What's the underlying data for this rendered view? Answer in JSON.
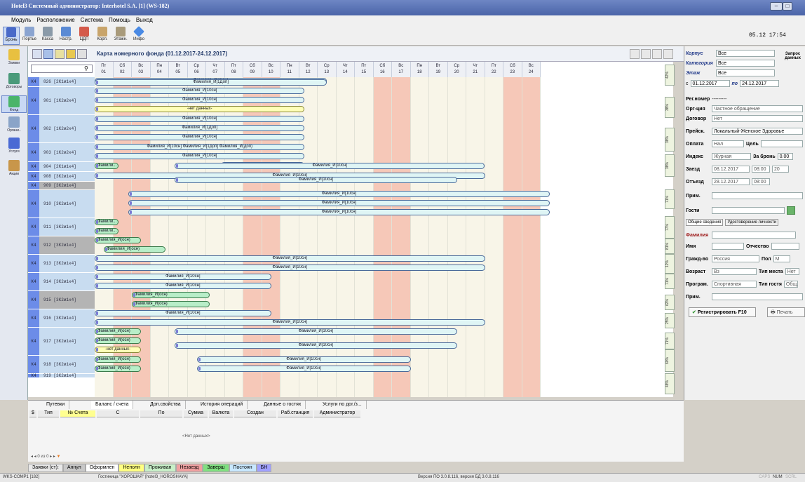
{
  "window": {
    "title": "Hotel3 Системный администратор: Interhotel S.A. [1] (WS-182)"
  },
  "menu": [
    "Модуль",
    "Расположение",
    "Система",
    "Помощь",
    "Выход"
  ],
  "toolbar": {
    "items": [
      "Бронь",
      "Портье",
      "Касса",
      "Настр.",
      "ЦДП",
      "Корп.",
      "Этажн.",
      "Инфо"
    ],
    "clock": "05.12 17:54"
  },
  "left_toolbar": [
    "Заявки",
    "Договоры",
    "Фонд",
    "Органи..",
    "Услуги",
    "Акции"
  ],
  "panel": {
    "title": "Карта номерного фонда (01.12.2017-24.12.2017)"
  },
  "days": [
    [
      "Пт",
      "01"
    ],
    [
      "Сб",
      "02"
    ],
    [
      "Вс",
      "03"
    ],
    [
      "Пн",
      "04"
    ],
    [
      "Вт",
      "05"
    ],
    [
      "Ср",
      "06"
    ],
    [
      "Чт",
      "07"
    ],
    [
      "Пт",
      "08"
    ],
    [
      "Сб",
      "09"
    ],
    [
      "Вс",
      "10"
    ],
    [
      "Пн",
      "11"
    ],
    [
      "Вт",
      "12"
    ],
    [
      "Ср",
      "13"
    ],
    [
      "Чт",
      "14"
    ],
    [
      "Пт",
      "15"
    ],
    [
      "Сб",
      "16"
    ],
    [
      "Вс",
      "17"
    ],
    [
      "Пн",
      "18"
    ],
    [
      "Вт",
      "19"
    ],
    [
      "Ср",
      "20"
    ],
    [
      "Чт",
      "21"
    ],
    [
      "Пт",
      "22"
    ],
    [
      "Сб",
      "23"
    ],
    [
      "Вс",
      "24"
    ]
  ],
  "rooms": [
    {
      "cat": "К4",
      "name": "826 [2К1м1к4]"
    },
    {
      "cat": "К4",
      "name": "901 [1К2м2к4]"
    },
    {
      "cat": "К4",
      "name": "902 [1К2м2к4]"
    },
    {
      "cat": "К4",
      "name": "903 [1К2м2к4]"
    },
    {
      "cat": "К4",
      "name": "904 [2К1м1к4]"
    },
    {
      "cat": "К4",
      "name": "908 [3К2м1к4]"
    },
    {
      "cat": "К4",
      "name": "909 [3К2м1к4]"
    },
    {
      "cat": "К4",
      "name": "910 [3К2м1к4]"
    },
    {
      "cat": "К4",
      "name": "911 [3К2м1к4]"
    },
    {
      "cat": "К4",
      "name": "912 [3К2м1к4]"
    },
    {
      "cat": "К4",
      "name": "913 [3К2м1к4]"
    },
    {
      "cat": "К4",
      "name": "914 [3К2м1к4]"
    },
    {
      "cat": "К4",
      "name": "915 [3К2м1к4]"
    },
    {
      "cat": "К4",
      "name": "916 [3К2м1к4]"
    },
    {
      "cat": "К4",
      "name": "917 [3К2м1к4]"
    },
    {
      "cat": "К4",
      "name": "918 [3К2м1к4]"
    },
    {
      "cat": "К4",
      "name": "919 [3К2м1к4]"
    }
  ],
  "bookings": {
    "b1": "Фамилия_И[10сн]",
    "b2": "Фамилия_И[1Доп]",
    "b3": "-нет данных-",
    "b4": "Фамилия_И(осн)",
    "b5": "Фамили...",
    "b6": "Фамилия_И(доп)",
    "b7": "$",
    "b8": "Фамилия_И[10сн] Фамилия_И[1Доп] Фамилия_И(доп)",
    "b9": "Фамилия_И[1Доп]",
    "b10": "Фамилия_И(осн)"
  },
  "occupancy": [
    "42%",
    "38%",
    "38%",
    "38%",
    "71%",
    "77%",
    "81%",
    "12%",
    "71%",
    "62%",
    "25%",
    "71%",
    "60%",
    "48%"
  ],
  "right": {
    "korpus_label": "Корпус",
    "korpus": "Все",
    "kategoriya_label": "Категория",
    "kategoriya": "Все",
    "etazh_label": "Этаж",
    "etazh": "Все",
    "zapros": "Запрос данных",
    "from_label": "с",
    "from": "01.12.2017",
    "to_label": "по",
    "to": "24.12.2017",
    "regnomer_label": "Рег.номер",
    "regnomer": "---------",
    "org_label": "Орг-ция",
    "org": "Частное обращение",
    "dogovor_label": "Договор",
    "dogovor": "Нет",
    "preisk_label": "Прейск.",
    "preisk": "Локальный-Женское Здоровье",
    "oplata_label": "Оплата",
    "oplata": "Нал",
    "cel_label": "Цель",
    "index_label": "Индекс",
    "index": "Журная",
    "zabron_label": "За бронь",
    "zabron": "0.00",
    "zaezd_label": "Заезд",
    "zaezd": "08.12.2017",
    "zaezd_time": "08:00",
    "zaezd_n": "20",
    "otezd_label": "Отъезд",
    "otezd": "28.12.2017",
    "otezd_time": "08:00",
    "prim_label": "Прим.",
    "gosti_label": "Гости",
    "tab1": "Общие сведения",
    "tab2": "Удостоверение личности",
    "familia_label": "Фамилия",
    "imya_label": "Имя",
    "otchestvo_label": "Отчество",
    "grazhd_label": "Гражд-во",
    "grazhd": "Россия",
    "pol_label": "Пол",
    "pol": "М",
    "vozrast_label": "Возраст",
    "vozrast": "Вз",
    "tipmesta_label": "Тип места",
    "tipmesta": "Нет",
    "program_label": "Програм.",
    "program": "Спортивная",
    "tipgostya_label": "Тип гостя",
    "tipgostya": "Общ.",
    "prim2_label": "Прим.",
    "register": "Регистрировать F10",
    "print": "Печать"
  },
  "bottom": {
    "tabs": [
      "Путевки",
      "Баланс / счета",
      "Доп.свойства",
      "История операций",
      "Данные о гостях",
      "Услуги по дог./з..."
    ],
    "cols": [
      "$",
      "Тип",
      "№ Счета",
      "С",
      "По",
      "Сумма",
      "Валюта",
      "Создан",
      "Раб.станция",
      "Администратор"
    ],
    "empty": "<Нет данных>",
    "pager": "0 из 0"
  },
  "legend": [
    {
      "t": "Заявки (ст):",
      "c": "#e8e8e8"
    },
    {
      "t": "Аннул",
      "c": "#c8c8c8"
    },
    {
      "t": "Оформлен",
      "c": "#ffffff"
    },
    {
      "t": "Неполн",
      "c": "#ffff80"
    },
    {
      "t": "Проживан",
      "c": "#c8f0c8"
    },
    {
      "t": "Незаезд",
      "c": "#f0a0a0"
    },
    {
      "t": "Заверш",
      "c": "#80e080"
    },
    {
      "t": "Постоян",
      "c": "#c8e8ff"
    },
    {
      "t": "БН",
      "c": "#a0a0ff"
    }
  ],
  "status": {
    "ws": "WKS-COMP1 [182]",
    "hotel": "Гостиница \"ХОРОШАЯ\" [hotel3_HOROSHAYA]",
    "version": "Версия ПО 3.0.8.116, версия БД 3.0.8.116",
    "caps": "CAPS",
    "num": "NUM",
    "scrl": "SCRL"
  }
}
